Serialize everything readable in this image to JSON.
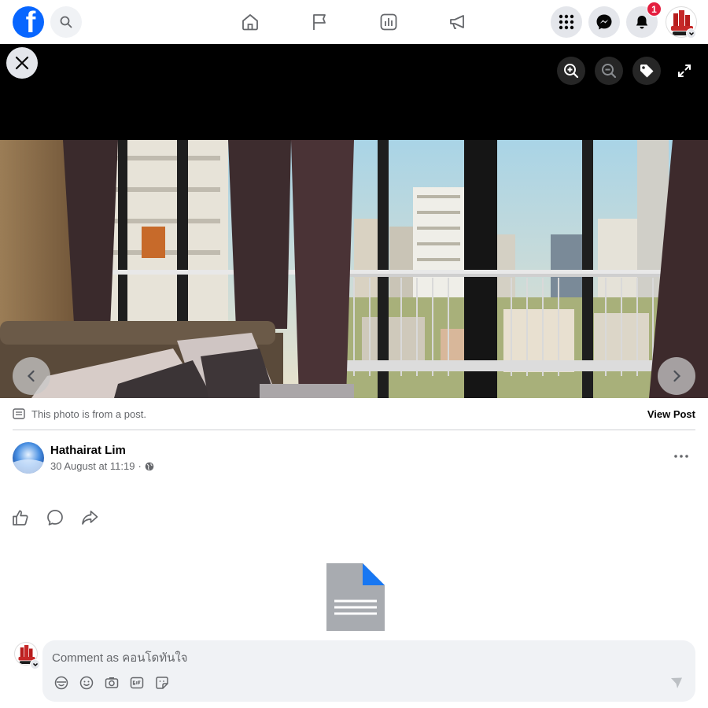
{
  "topbar": {
    "logo_letter": "f",
    "nav": [
      "home-icon",
      "pages-flag-icon",
      "insights-icon",
      "ads-megaphone-icon"
    ],
    "notification_count": "1",
    "accent": "#0866ff"
  },
  "viewer": {
    "tools": [
      "zoom-in-icon",
      "zoom-out-icon",
      "tag-icon",
      "fullscreen-icon"
    ]
  },
  "post_info": {
    "from_post_text": "This photo is from a post.",
    "view_post_label": "View Post"
  },
  "author": {
    "name": "Hathairat Lim",
    "timestamp": "30 August at 11:19",
    "separator": "·",
    "audience_icon": "globe-icon"
  },
  "comment": {
    "placeholder": "Comment as คอนโดทันใจ",
    "tools": [
      "avatar-sticker-icon",
      "emoji-icon",
      "camera-icon",
      "gif-icon",
      "sticker-icon"
    ],
    "send_icon": "send-icon"
  }
}
